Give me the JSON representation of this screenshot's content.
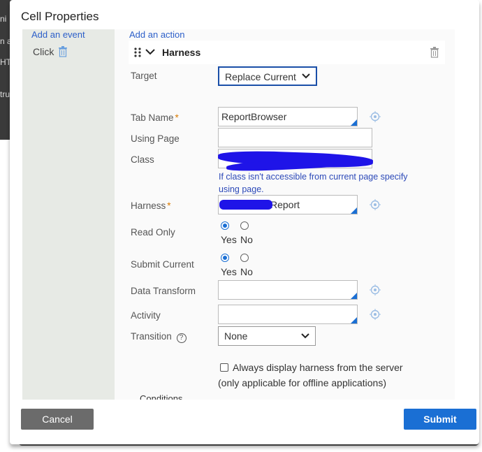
{
  "dialog": {
    "title": "Cell Properties"
  },
  "bg_fragments": [
    "ni",
    "n a",
    "HT",
    "tru"
  ],
  "events": {
    "add_event_label": "Add an event",
    "items": [
      {
        "label": "Click"
      }
    ]
  },
  "actions": {
    "add_action_label": "Add an action",
    "current": {
      "name": "Harness"
    }
  },
  "form": {
    "target": {
      "label": "Target",
      "value": "Replace Current"
    },
    "tab_name": {
      "label": "Tab Name",
      "required": "*",
      "value": "ReportBrowser"
    },
    "using_page": {
      "label": "Using Page",
      "value": ""
    },
    "class": {
      "label": "Class",
      "value": "",
      "hint": "If class isn't accessible from current page specify using page."
    },
    "harness": {
      "label": "Harness",
      "required": "*",
      "value_suffix": "Report"
    },
    "read_only": {
      "label": "Read Only",
      "yes": "Yes",
      "no": "No",
      "selected": "Yes"
    },
    "submit_current": {
      "label": "Submit Current",
      "yes": "Yes",
      "no": "No",
      "selected": "Yes"
    },
    "data_transform": {
      "label": "Data Transform",
      "value": ""
    },
    "activity": {
      "label": "Activity",
      "value": ""
    },
    "transition": {
      "label": "Transition",
      "value": "None",
      "help_icon": "?"
    },
    "always_display": {
      "label": "Always display harness from the server",
      "note": "(only applicable for offline applications)",
      "checked": false
    },
    "conditions_label": "Conditions"
  },
  "footer": {
    "cancel_label": "Cancel",
    "submit_label": "Submit"
  },
  "colors": {
    "accent": "#1a6fd4",
    "link": "#2c5fc9",
    "submit_bg": "#1a6fd4",
    "cancel_bg": "#6b6b6b",
    "required": "#d97a00"
  }
}
